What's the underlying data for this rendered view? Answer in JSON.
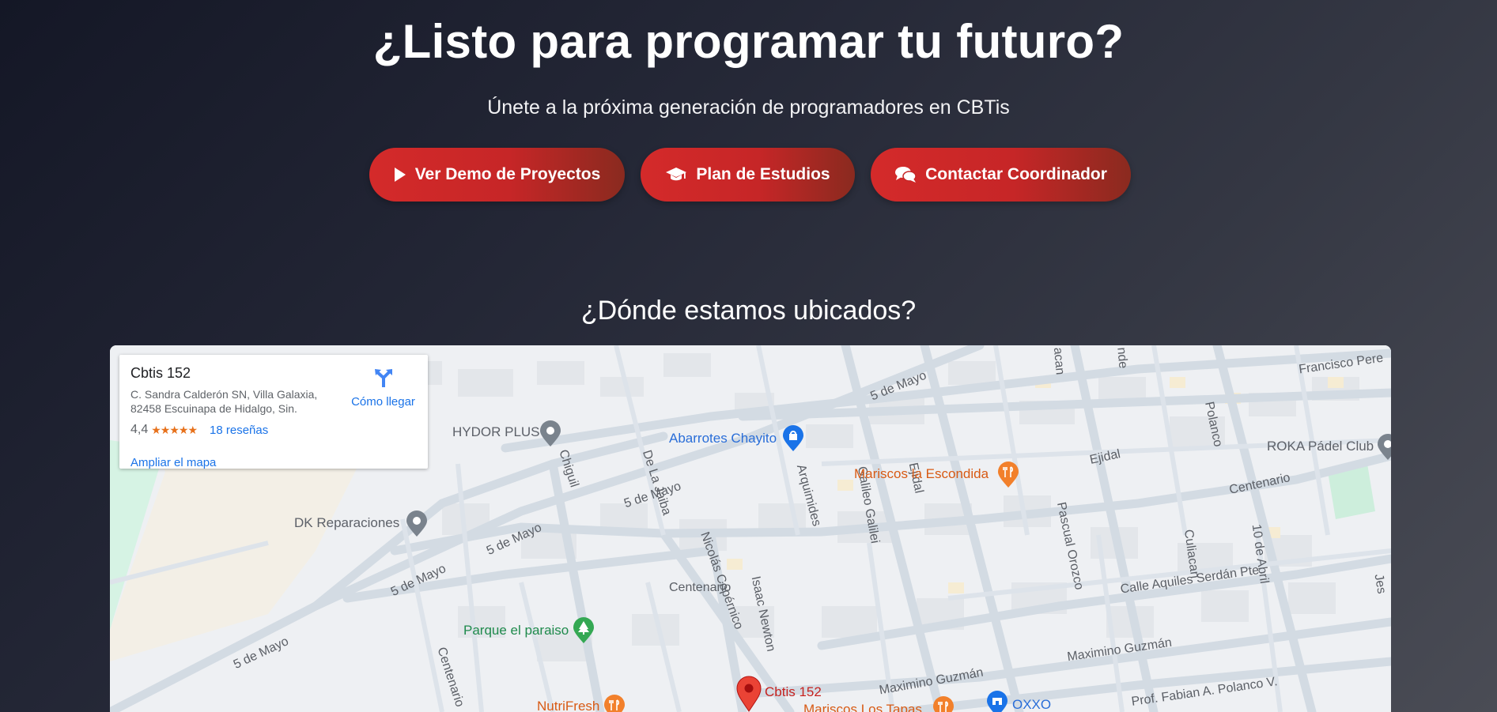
{
  "hero": {
    "title": "¿Listo para programar tu futuro?",
    "subtitle": "Únete a la próxima generación de programadores en CBTis"
  },
  "buttons": [
    {
      "label": "Ver Demo de Proyectos",
      "icon": "play-icon"
    },
    {
      "label": "Plan de Estudios",
      "icon": "graduation-cap-icon"
    },
    {
      "label": "Contactar Coordinador",
      "icon": "chat-bubbles-icon"
    }
  ],
  "location": {
    "title": "¿Dónde estamos ubicados?"
  },
  "map": {
    "card": {
      "place_name": "Cbtis 152",
      "address_line1": "C. Sandra Calderón SN, Villa Galaxia,",
      "address_line2": "82458 Escuinapa de Hidalgo, Sin.",
      "rating": "4,4",
      "stars": "★★★★★",
      "reviews": "18 reseñas",
      "directions": "Cómo llegar",
      "enlarge": "Ampliar el mapa"
    },
    "pois": {
      "hydor": "HYDOR PLUS",
      "abarrotes": "Abarrotes Chayito",
      "mariscos_escondida": "Mariscos la Escondida",
      "roka": "ROKA Pádel Club",
      "dk": "DK Reparaciones",
      "parque": "Parque el paraiso",
      "cbtis": "Cbtis 152",
      "nutrifresh": "NutriFresh",
      "mariscos_tapas": "Mariscos Los Tapas",
      "oxxo": "OXXO"
    },
    "streets": {
      "cinco_mayo_top": "5 de Mayo",
      "cinco_mayo_mid": "5 de Mayo",
      "cinco_mayo_left": "5 de Mayo",
      "cinco_mayo_low": "5 de Mayo",
      "cinco_mayo_bottom": "5 de Mayo",
      "francisco": "Francisco Pere",
      "acan": "acan",
      "nde": "nde",
      "polanco": "Polanco",
      "ejidal_h": "Ejidal",
      "ejidal_v": "Ejidal",
      "centenario_right": "Centenario",
      "centenario_mid": "Centenario",
      "centenario_left": "Centenario",
      "de_la_jaiba": "De La Jaiba",
      "chiguil": "Chiguil",
      "arquimides": "Arquimides",
      "galileo": "Galileo Galilei",
      "pascual": "Pascual Orozco",
      "culiacan": "Culiacan",
      "diez_abril": "10 de Abril",
      "aquiles": "Calle Aquiles Serdán Pte.",
      "nicolas": "Nicolás Copérnico",
      "isaac": "Isaac Newton",
      "maximino_right": "Maximino Guzmán",
      "maximino_low": "Maximino Guzmán",
      "fabian": "Prof. Fabian A. Polanco V.",
      "jes": "Jes"
    }
  }
}
